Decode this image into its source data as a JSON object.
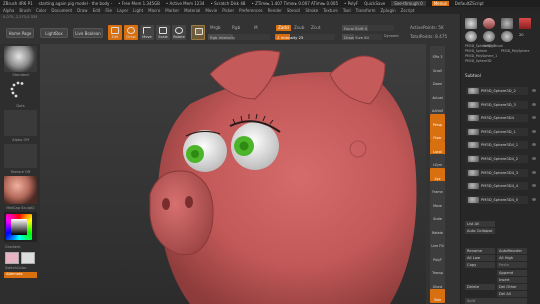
{
  "titlebar": {
    "app": "ZBrush 4R6 P1",
    "doc": "starting again pig model - the body -",
    "free_mem": "• Free Mem 1.345GB",
    "active_mem": "• Active Mem 1234",
    "scratch": "• Scratch Disk 48",
    "ztime": "• ZTime▸ 1.407 Timer▸ 0.007 ATime▸ 0.005",
    "polys": "• PolyF",
    "quicksave": "QuickSave",
    "see_through": "See-through  0",
    "menus": "Menus",
    "script": "DefaultZScript"
  },
  "menubar": [
    "Alpha",
    "Brush",
    "Color",
    "Document",
    "Draw",
    "Edit",
    "File",
    "Layer",
    "Light",
    "Macro",
    "Marker",
    "Material",
    "Movie",
    "Picker",
    "Preferences",
    "Render",
    "Stencil",
    "Stroke",
    "Texture",
    "Tool",
    "Transform",
    "Zplugin",
    "Zscript"
  ],
  "coords": "0.075,-2.273,0.335",
  "shelf": {
    "home_page": "Home Page",
    "lightbox": "LightBox",
    "live_boolean": "Live Boolean",
    "tools": [
      {
        "label": "Edit",
        "icon": "edit-icon"
      },
      {
        "label": "Draw",
        "icon": "draw-icon"
      },
      {
        "label": "Move",
        "icon": "move-icon"
      },
      {
        "label": "Scale",
        "icon": "scale-icon"
      },
      {
        "label": "Rotate",
        "icon": "rotate-icon"
      }
    ],
    "mrgb": "Mrgb",
    "rgb": "Rgb",
    "m": "M",
    "rgb_intensity": "Rgb Intensity",
    "zadd": "Zadd",
    "zsub": "Zsub",
    "zcut": "Zcut",
    "z_intensity": "Z Intensity 25",
    "focal_shift": "Focal Shift 0",
    "draw_size": "Draw Size 64",
    "dynamic": "Dynamic",
    "active_points": "ActivePoints: 5K",
    "total_points": "TotalPoints: 8.475"
  },
  "left_panel": {
    "brush_label": "Standard",
    "stroke_label": "Dots",
    "alpha_label": "Alpha Off",
    "texture_label": "Texture Off",
    "material_label": "MatCap Sculpt2",
    "gradient": "Gradient",
    "switch_color": "SwitchColor",
    "alternate": "Alternate"
  },
  "right_tools": [
    {
      "label": "SPix 3",
      "orange": false
    },
    {
      "label": "Scroll",
      "orange": false
    },
    {
      "label": "Zoom",
      "orange": false
    },
    {
      "label": "Actual",
      "orange": false
    },
    {
      "label": "AAHalf",
      "orange": false
    },
    {
      "label": "Persp",
      "orange": true
    },
    {
      "label": "Floor",
      "orange": true
    },
    {
      "label": "Local",
      "orange": true
    },
    {
      "label": "LSym",
      "orange": false
    },
    {
      "label": "Xyz",
      "orange": true
    },
    {
      "label": "Frame",
      "orange": false
    },
    {
      "label": "Move",
      "orange": false
    },
    {
      "label": "Scale",
      "orange": false
    },
    {
      "label": "Rotate",
      "orange": false
    },
    {
      "label": "Line Fill",
      "orange": false
    },
    {
      "label": "PolyF",
      "orange": false
    },
    {
      "label": "Transp",
      "orange": false
    },
    {
      "label": "Ghost",
      "orange": false
    },
    {
      "label": "Solo",
      "orange": true
    }
  ],
  "subtool_panel": {
    "top_items": [
      "PM3D_Sphere3D_1",
      "Cylinder3D",
      "PolyMesh3D",
      "SimpleBrush",
      "PM3D_Sphere",
      "PM3D_PolySphere",
      "PM3D_PolySphere_1",
      "PM3D_Sphere3D"
    ],
    "counter": "20",
    "section_title": "Subtool",
    "items": [
      "PM3D_Sphere3D_2",
      "PM3D_Sphere3D_3",
      "PM3D_Sphere3D4",
      "PM3D_Sphere3D_1",
      "PM3D_Sphere3D4_1",
      "PM3D_Sphere3D4_2",
      "PM3D_Sphere3D4_3",
      "PM3D_Sphere3D4_4",
      "PM3D_Sphere3D4_5"
    ],
    "list_all": "List All",
    "auto_collapse": "Auto Collapse",
    "rename": "Rename",
    "auto_reorder": "AutoReorder",
    "all_low": "All Low",
    "all_high": "All High",
    "copy": "Copy",
    "paste": "Paste",
    "append": "Append",
    "insert": "Insert",
    "delete": "Delete",
    "del_other": "Del Other",
    "del_all": "Del All",
    "split": "Split"
  },
  "colors": {
    "accent": "#d8700f",
    "pig_skin": "#c55a5a",
    "eye_green": "#4db52a"
  }
}
